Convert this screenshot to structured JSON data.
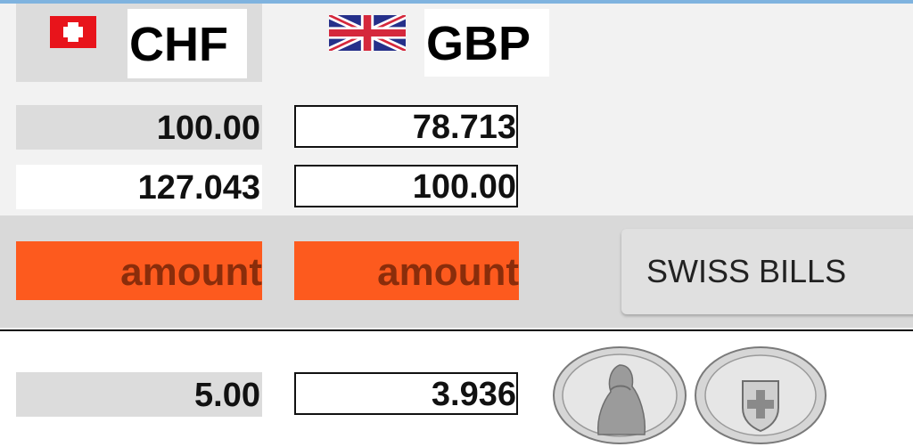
{
  "header": {
    "from_currency": "CHF",
    "to_currency": "GBP"
  },
  "rows": [
    {
      "chf": "100.00",
      "gbp": "78.713"
    },
    {
      "chf": "127.043",
      "gbp": "100.00"
    }
  ],
  "actions": {
    "amount_left": "amount",
    "amount_right": "amount",
    "swiss_bills": "SWISS BILLS"
  },
  "coin_row": {
    "chf": "5.00",
    "gbp": "3.936"
  },
  "colors": {
    "accent_orange": "#fd5a1e",
    "swiss_red": "#e8141b"
  },
  "icons": [
    "swiss-flag-icon",
    "uk-flag-icon",
    "coin-front-icon",
    "coin-back-icon"
  ]
}
